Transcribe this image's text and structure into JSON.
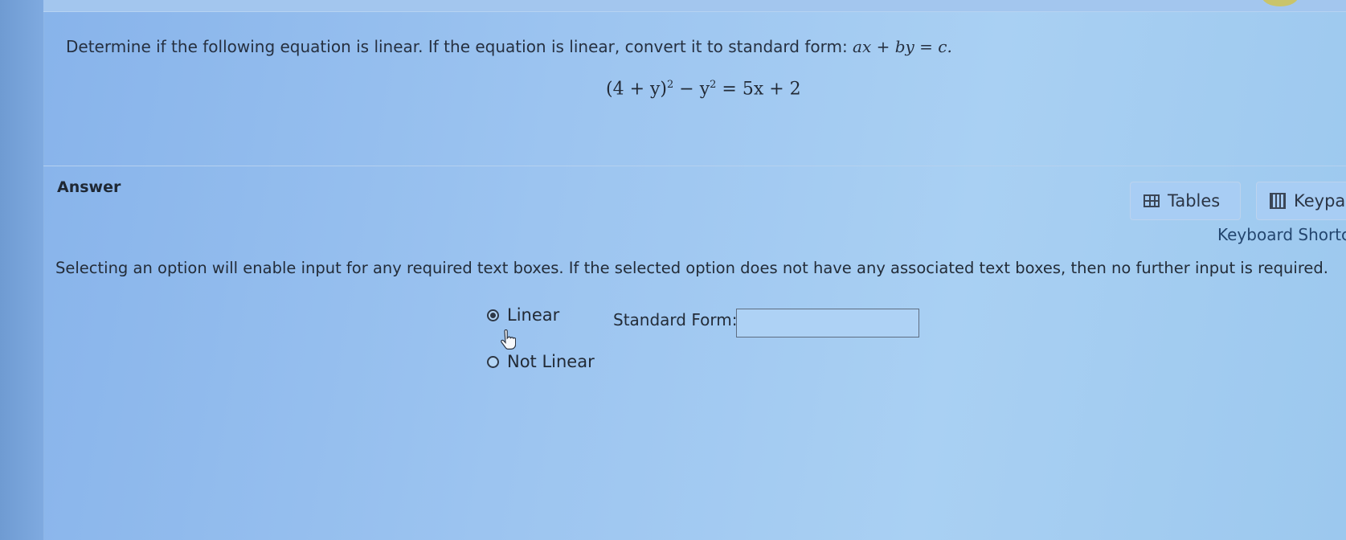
{
  "question": {
    "prompt_text": "Determine if the following equation is linear. If the equation is linear, convert it to standard form: ",
    "standard_form_math": "ax + by = c.",
    "equation_left": "(4 + y)",
    "equation_exp1": "2",
    "equation_minus_y": " − y",
    "equation_exp2": "2",
    "equation_right": " = 5x + 2"
  },
  "answer": {
    "label": "Answer",
    "tables_label": "Tables",
    "keypad_label": "Keypa",
    "shortcuts_label": "Keyboard Shortc",
    "instructions": "Selecting an option will enable input for any required text boxes. If the selected option does not have any associated text boxes, then no further input is required.",
    "options": [
      {
        "label": "Linear",
        "selected": true
      },
      {
        "label": "Not Linear",
        "selected": false
      }
    ],
    "standard_form_label": "Standard Form:",
    "standard_form_value": ""
  },
  "icons": {
    "tables": "table-grid-icon",
    "keypad": "calculator-icon",
    "cursor": "hand-pointer-icon"
  },
  "colors": {
    "background": "#9cc4f0",
    "text": "#232c38",
    "link": "#24466f"
  }
}
